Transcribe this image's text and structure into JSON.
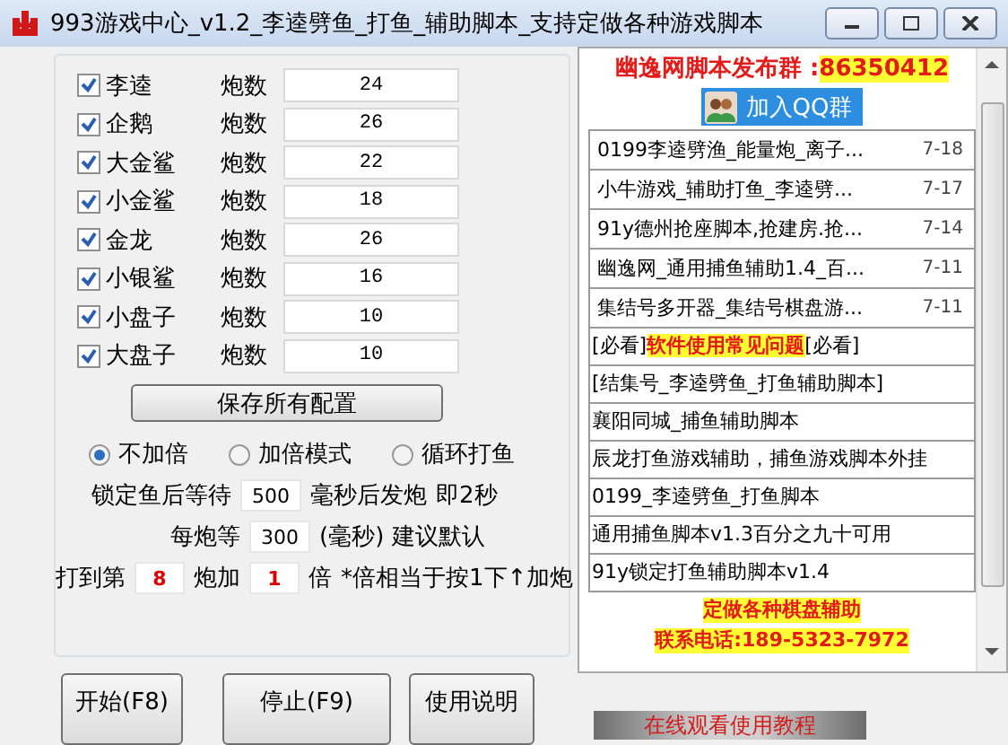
{
  "window": {
    "title": "993游戏中心_v1.2_李逵劈鱼_打鱼_辅助脚本_支持定做各种游戏脚本"
  },
  "fish": [
    {
      "name": "李逵",
      "checked": true,
      "label": "炮数",
      "value": "24"
    },
    {
      "name": "企鹅",
      "checked": true,
      "label": "炮数",
      "value": "26"
    },
    {
      "name": "大金鲨",
      "checked": true,
      "label": "炮数",
      "value": "22"
    },
    {
      "name": "小金鲨",
      "checked": true,
      "label": "炮数",
      "value": "18"
    },
    {
      "name": "金龙",
      "checked": true,
      "label": "炮数",
      "value": "26"
    },
    {
      "name": "小银鲨",
      "checked": true,
      "label": "炮数",
      "value": "16"
    },
    {
      "name": "小盘子",
      "checked": true,
      "label": "炮数",
      "value": "10"
    },
    {
      "name": "大盘子",
      "checked": true,
      "label": "炮数",
      "value": "10"
    }
  ],
  "save_button": "保存所有配置",
  "modes": [
    {
      "label": "不加倍",
      "selected": true
    },
    {
      "label": "加倍模式",
      "selected": false
    },
    {
      "label": "循环打鱼",
      "selected": false
    }
  ],
  "lock_wait": {
    "label": "锁定鱼后等待",
    "value": "500",
    "suffix": "毫秒后发炮",
    "note": "即2秒"
  },
  "shot_wait": {
    "label": "每炮等",
    "value": "300",
    "suffix": "(毫秒) 建议默认"
  },
  "double": {
    "label": "打到第",
    "value": "8",
    "middle": "炮加",
    "value2": "1",
    "suffix": "倍",
    "note": "*倍相当于按1下↑加炮"
  },
  "buttons": [
    "开始(F8)",
    "停止(F9)",
    "使用说明"
  ],
  "sidebar": {
    "group_title": "幽逸网脚本发布群 :",
    "group_number": "86350412",
    "qq_button": "加入QQ群",
    "items": [
      {
        "kind": "dated",
        "title": "0199李逵劈渔_能量炮_离子...",
        "date": "7-18"
      },
      {
        "kind": "dated",
        "title": "小牛游戏_辅助打鱼_李逵劈...",
        "date": "7-17"
      },
      {
        "kind": "dated",
        "title": "91y德州抢座脚本,抢建房.抢...",
        "date": "7-14"
      },
      {
        "kind": "dated",
        "title": "幽逸网_通用捕鱼辅助1.4_百...",
        "date": "7-11"
      },
      {
        "kind": "dated",
        "title": "集结号多开器_集结号棋盘游...",
        "date": "7-11"
      },
      {
        "kind": "plain",
        "title": "[必看]**软件使用常见问题**[必看]"
      },
      {
        "kind": "plain",
        "title": " [结集号_李逵劈鱼_打鱼辅助脚本]"
      },
      {
        "kind": "plain",
        "title": "襄阳同城_捕鱼辅助脚本"
      },
      {
        "kind": "plain",
        "title": "辰龙打鱼游戏辅助，捕鱼游戏脚本外挂"
      },
      {
        "kind": "plain",
        "title": "0199_李逵劈鱼_打鱼脚本"
      },
      {
        "kind": "plain",
        "title": "通用捕鱼脚本v1.3百分之九十可用"
      },
      {
        "kind": "plain",
        "title": "91y锁定打鱼辅助脚本v1.4"
      }
    ],
    "ads": [
      "定做各种棋盘辅助",
      "联系电话:189-5323-7972"
    ]
  },
  "tutorial_link": "在线观看使用教程"
}
